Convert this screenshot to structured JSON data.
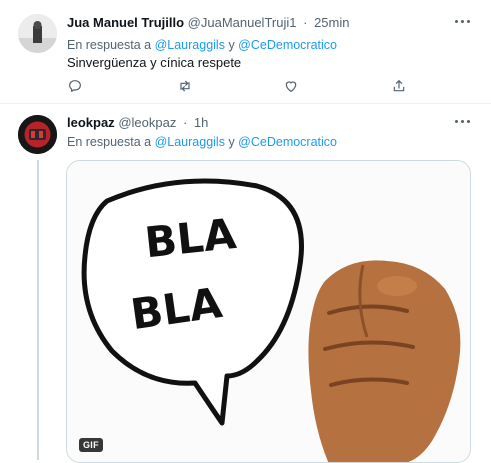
{
  "tweets": [
    {
      "display_name": "Jua Manuel Trujillo",
      "handle": "@JuaManuelTruji1",
      "separator": "·",
      "time": "25min",
      "reply_prefix": "En respuesta a",
      "mentions": [
        "@Lauraggils",
        "@CeDemocratico"
      ],
      "mention_join": "y",
      "text": "Sinvergüenza y cínica respete",
      "actions": [
        "reply-icon",
        "retweet-icon",
        "like-icon",
        "share-icon"
      ]
    },
    {
      "display_name": "leokpaz",
      "handle": "@leokpaz",
      "separator": "·",
      "time": "1h",
      "reply_prefix": "En respuesta a",
      "mentions": [
        "@Lauraggils",
        "@CeDemocratico"
      ],
      "mention_join": "y",
      "media": {
        "type": "gif",
        "badge": "GIF",
        "caption_lines": [
          "BLA",
          "BLA"
        ]
      }
    }
  ],
  "colors": {
    "link": "#1d9bf0",
    "secondary_text": "#536471",
    "divider": "#eff3f4"
  }
}
